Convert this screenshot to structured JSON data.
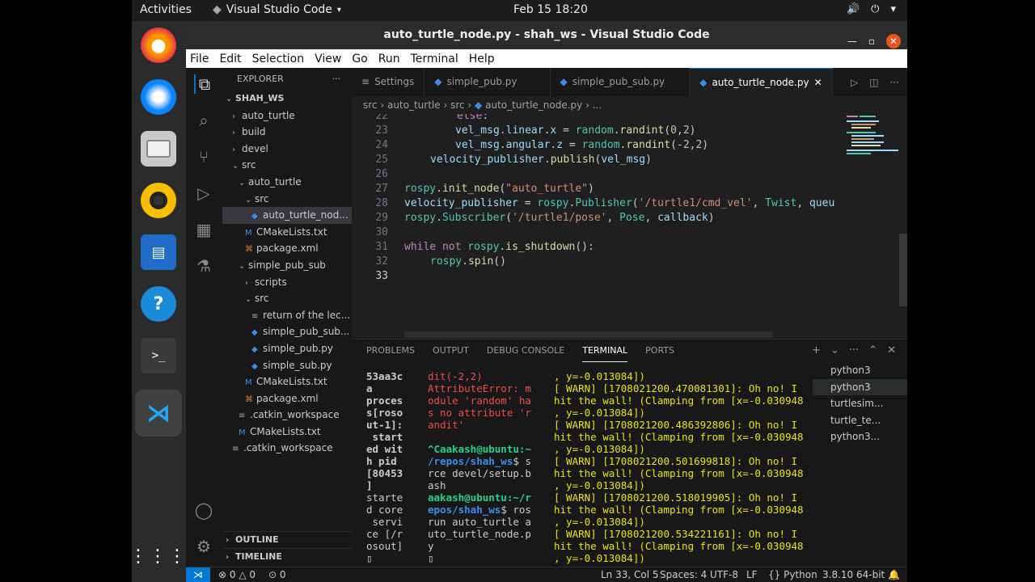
{
  "system": {
    "activities": "Activities",
    "app_name": "Visual Studio Code",
    "clock": "Feb 15  18:20"
  },
  "window": {
    "title": "auto_turtle_node.py - shah_ws - Visual Studio Code"
  },
  "menu": [
    "File",
    "Edit",
    "Selection",
    "View",
    "Go",
    "Run",
    "Terminal",
    "Help"
  ],
  "explorer": {
    "header": "EXPLORER",
    "workspace": "SHAH_WS",
    "items": [
      {
        "label": "auto_turtle",
        "kind": "folder-closed",
        "depth": 1
      },
      {
        "label": "build",
        "kind": "folder-closed",
        "depth": 1
      },
      {
        "label": "devel",
        "kind": "folder-closed",
        "depth": 1
      },
      {
        "label": "src",
        "kind": "folder-open",
        "depth": 1
      },
      {
        "label": "auto_turtle",
        "kind": "folder-open",
        "depth": 2
      },
      {
        "label": "src",
        "kind": "folder-open",
        "depth": 3
      },
      {
        "label": "auto_turtle_nod...",
        "kind": "python",
        "depth": 4,
        "selected": true
      },
      {
        "label": "CMakeLists.txt",
        "kind": "cmake",
        "depth": 3
      },
      {
        "label": "package.xml",
        "kind": "xml",
        "depth": 3
      },
      {
        "label": "simple_pub_sub",
        "kind": "folder-open",
        "depth": 2
      },
      {
        "label": "scripts",
        "kind": "folder-closed",
        "depth": 3
      },
      {
        "label": "src",
        "kind": "folder-open",
        "depth": 3
      },
      {
        "label": "return of the lec...",
        "kind": "text",
        "depth": 4
      },
      {
        "label": "simple_pub_sub...",
        "kind": "python",
        "depth": 4
      },
      {
        "label": "simple_pub.py",
        "kind": "python",
        "depth": 4
      },
      {
        "label": "simple_sub.py",
        "kind": "python",
        "depth": 4
      },
      {
        "label": "CMakeLists.txt",
        "kind": "cmake",
        "depth": 3
      },
      {
        "label": "package.xml",
        "kind": "xml",
        "depth": 3
      },
      {
        "label": ".catkin_workspace",
        "kind": "text",
        "depth": 2
      },
      {
        "label": "CMakeLists.txt",
        "kind": "cmake",
        "depth": 2
      },
      {
        "label": ".catkin_workspace",
        "kind": "text",
        "depth": 1
      }
    ],
    "outline": "OUTLINE",
    "timeline": "TIMELINE"
  },
  "tabs": [
    {
      "label": "Settings",
      "icon": "settings-icon"
    },
    {
      "label": "simple_pub.py",
      "icon": "python-icon"
    },
    {
      "label": "simple_pub_sub.py",
      "icon": "python-icon"
    },
    {
      "label": "auto_turtle_node.py",
      "icon": "python-icon",
      "active": true
    }
  ],
  "breadcrumb": [
    "src",
    "auto_turtle",
    "src",
    "auto_turtle_node.py",
    "..."
  ],
  "code": {
    "lines": [
      22,
      23,
      24,
      25,
      26,
      27,
      28,
      29,
      30,
      31,
      32,
      33
    ]
  },
  "panel": {
    "tabs": [
      "PROBLEMS",
      "OUTPUT",
      "DEBUG CONSOLE",
      "TERMINAL",
      "PORTS"
    ],
    "active": "TERMINAL",
    "terminals": [
      "python3",
      "python3",
      "turtlesim...",
      "turtle_te...",
      "python3..."
    ]
  },
  "status": {
    "errors": "0",
    "warnings": "0",
    "ports": "0",
    "position": "Ln 33, Col 5",
    "spaces": "Spaces: 4",
    "encoding": "UTF-8",
    "eol": "LF",
    "language": "Python",
    "interpreter": "3.8.10 64-bit"
  }
}
